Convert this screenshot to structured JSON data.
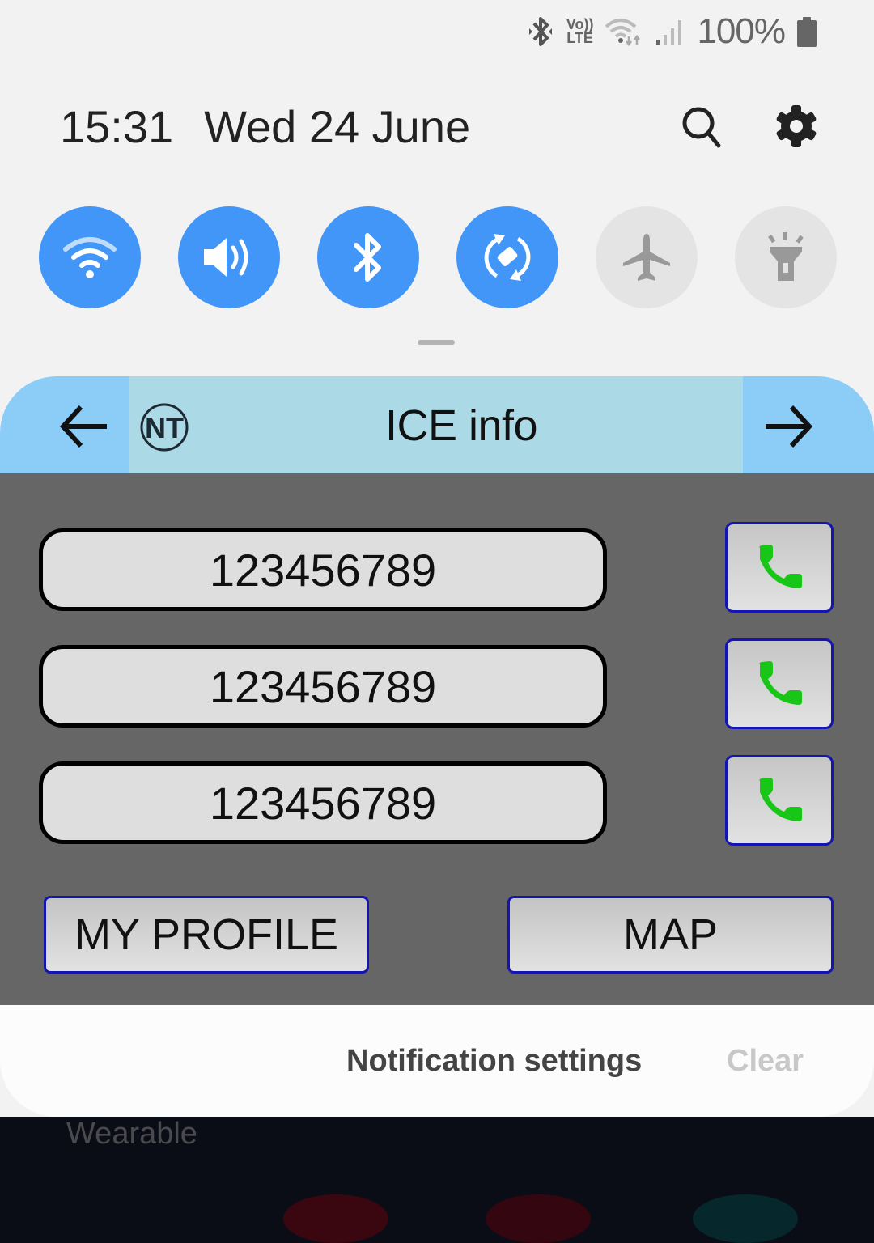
{
  "status_bar": {
    "icons": [
      "bluetooth-icon",
      "volte-icon",
      "wifi-data-icon",
      "signal-icon",
      "battery-icon"
    ],
    "volte_top": "Vo))",
    "volte_bottom": "LTE",
    "battery_percent": "100%"
  },
  "header": {
    "time": "15:31",
    "date": "Wed 24 June",
    "search_icon": "search-icon",
    "settings_icon": "gear-icon"
  },
  "quick_toggles": [
    {
      "name": "Wi-Fi",
      "icon": "wifi-icon",
      "state": "on"
    },
    {
      "name": "Sound",
      "icon": "volume-icon",
      "state": "on"
    },
    {
      "name": "Bluetooth",
      "icon": "bluetooth-icon",
      "state": "on"
    },
    {
      "name": "Auto rotate",
      "icon": "rotate-icon",
      "state": "on"
    },
    {
      "name": "Airplane mode",
      "icon": "airplane-icon",
      "state": "off"
    },
    {
      "name": "Flashlight",
      "icon": "flashlight-icon",
      "state": "off"
    }
  ],
  "colors": {
    "toggle_on": "#4296f7",
    "toggle_off": "#e4e4e4",
    "header_outer": "#8ccdf8",
    "header_inner": "#acd9e6",
    "body_bg": "#666666",
    "call_icon": "#17c617",
    "button_border": "#1414b4"
  },
  "notification": {
    "title": "ICE info",
    "logo_text": "NT",
    "back_icon": "arrow-left-icon",
    "forward_icon": "arrow-right-icon",
    "contacts": [
      {
        "number": "123456789",
        "call_icon": "phone-icon"
      },
      {
        "number": "123456789",
        "call_icon": "phone-icon"
      },
      {
        "number": "123456789",
        "call_icon": "phone-icon"
      }
    ],
    "my_profile_label": "MY PROFILE",
    "map_label": "MAP"
  },
  "footer": {
    "notification_settings": "Notification settings",
    "clear": "Clear"
  },
  "home_screen": {
    "folder_label": "Wearable"
  }
}
